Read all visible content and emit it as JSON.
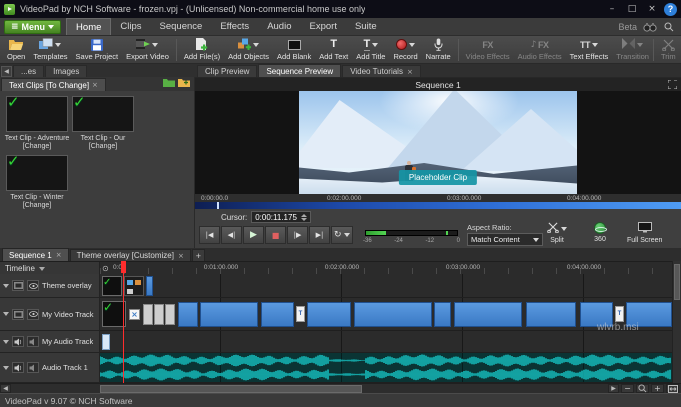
{
  "titlebar": {
    "title": "VideoPad by NCH Software - frozen.vpj - (Unlicensed) Non-commercial home use only"
  },
  "menubar": {
    "menu_label": "Menu",
    "tabs": [
      {
        "label": "Home"
      },
      {
        "label": "Clips"
      },
      {
        "label": "Sequence"
      },
      {
        "label": "Effects"
      },
      {
        "label": "Audio"
      },
      {
        "label": "Export"
      },
      {
        "label": "Suite"
      }
    ],
    "beta": "Beta"
  },
  "toolbar": {
    "open": "Open",
    "templates": "Templates",
    "save_project": "Save Project",
    "export_video": "Export Video",
    "add_files": "Add File(s)",
    "add_objects": "Add Objects",
    "add_blank": "Add Blank",
    "add_text": "Add Text",
    "add_title": "Add Title",
    "record": "Record",
    "narrate": "Narrate",
    "video_effects": "Video Effects",
    "audio_effects": "Audio Effects",
    "text_effects": "Text Effects",
    "transition": "Transition",
    "trim": "Trim"
  },
  "bin": {
    "tab_prev": "...es",
    "tab_images": "Images",
    "tab_textclips": "Text Clips [To Change]",
    "clips": [
      {
        "line1": "Text Clip - Adventure",
        "line2": "[Change]"
      },
      {
        "line1": "Text Clip - Our",
        "line2": "[Change]"
      },
      {
        "line1": "Text Clip - Winter",
        "line2": "[Change]"
      }
    ]
  },
  "preview": {
    "tab_clip": "Clip Preview",
    "tab_sequence": "Sequence Preview",
    "tab_tutorials": "Video Tutorials",
    "header": "Sequence 1",
    "placeholder": "Placeholder Clip",
    "ruler": [
      "0:00:00.0",
      "0:02:00.000",
      "0:03:00.000",
      "0:04:00.000"
    ],
    "cursor_label": "Cursor:",
    "cursor_value": "0:00:11.175",
    "meter": [
      "-36",
      "-24",
      "-12",
      "0"
    ],
    "aspect_label": "Aspect Ratio:",
    "aspect_value": "Match Content",
    "split": "Split",
    "deg360": "360",
    "fullscreen": "Full Screen"
  },
  "timeline": {
    "tab1": "Sequence 1",
    "tab2": "Theme overlay [Customize]",
    "add_tab": "+",
    "panel_label": "Timeline",
    "ruler0": "0:00",
    "ruler": [
      "0:01:00.000",
      "0:02:00.000",
      "0:03:00.000",
      "0:04:00.000"
    ],
    "tracks": [
      {
        "name": "Theme overlay"
      },
      {
        "name": "My Video Track"
      },
      {
        "name": "My Audio Track"
      },
      {
        "name": "Audio Track 1"
      }
    ]
  },
  "statusbar": {
    "text": "VideoPad v 9.07 © NCH Software"
  },
  "watermark": "wlvrb.msi",
  "icons": {
    "menu": "≡",
    "minimize": "–",
    "maximize": "□",
    "close": "×",
    "help": "?",
    "check": "✓",
    "tab_close": "×",
    "go_start": "|◀",
    "frame_back": "◀|",
    "play": "▶",
    "stop": "■",
    "frame_fwd": "|▶",
    "go_end": "▶|",
    "loop": "↻",
    "trans_x": "×",
    "t_mini": "T",
    "ruler_marker": "⊙",
    "scroll_left": "◀",
    "scroll_right": "▶",
    "zoom_out": "−",
    "zoom_in": "+",
    "fx": "FX",
    "tt": "TT",
    "t_letter": "T",
    "note": "♪"
  }
}
